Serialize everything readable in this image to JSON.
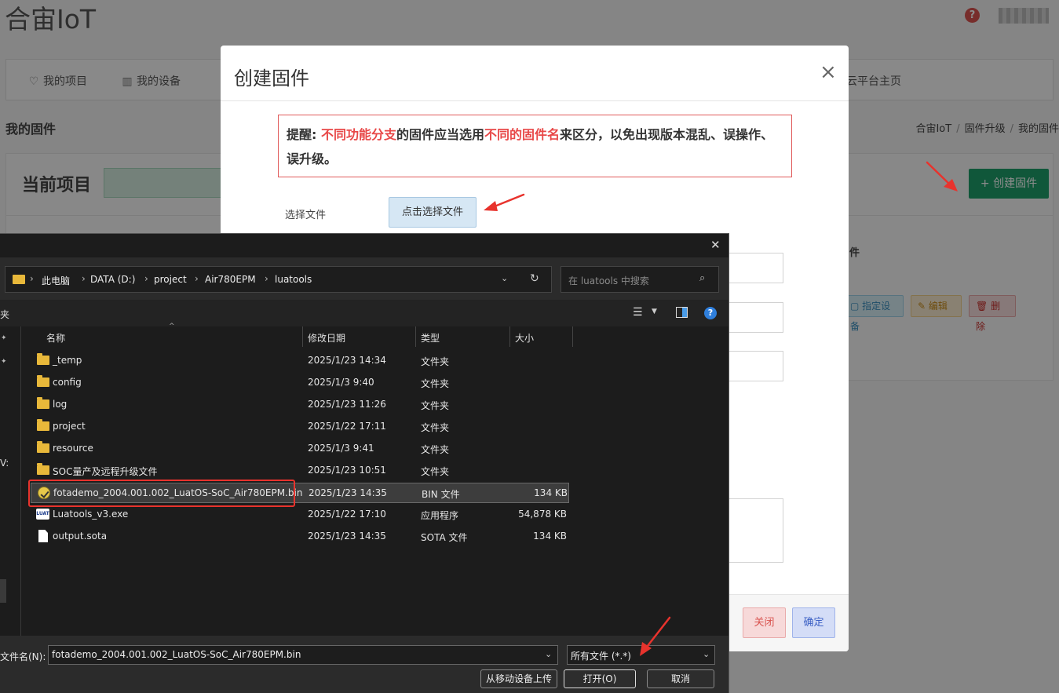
{
  "bg": {
    "brand": "合宙IoT",
    "help_icon": "?",
    "nav": [
      {
        "label": "我的项目",
        "icon": "lightbulb-icon",
        "glyph": "♡"
      },
      {
        "label": "我的设备",
        "icon": "chip-icon",
        "glyph": "▥"
      },
      {
        "label": "云平台主页",
        "icon": "",
        "glyph": ""
      }
    ],
    "page_title": "我的固件",
    "breadcrumb": [
      "合宙IoT",
      "固件升级",
      "我的固件"
    ],
    "current_project": "当前项目",
    "create_button": "+ 创建固件",
    "column_header": "件",
    "actions": {
      "assign": "指定设备",
      "edit": "编辑",
      "delete": "删除"
    }
  },
  "modal": {
    "title": "创建固件",
    "close_glyph": "×",
    "notice": {
      "prefix": "提醒: ",
      "hl1": "不同功能分支",
      "mid": "的固件应当选用",
      "hl2": "不同的固件名",
      "suffix": "来区分，以免出现版本混乱、误操作、误升级。"
    },
    "select_file_label": "选择文件",
    "select_file_button": "点击选择文件",
    "close_button": "关闭",
    "ok_button": "确定"
  },
  "file_dialog": {
    "close_glyph": "✕",
    "breadcrumb": [
      "此电脑",
      "DATA (D:)",
      "project",
      "Air780EPM",
      "luatools"
    ],
    "search_placeholder": "在 luatools 中搜索",
    "toolbar_left": "夹",
    "nav_fragment": "V:",
    "columns": {
      "name": "名称",
      "date": "修改日期",
      "type": "类型",
      "size": "大小"
    },
    "files": [
      {
        "name": "_temp",
        "date": "2025/1/23 14:34",
        "type": "文件夹",
        "size": "",
        "icon": "folder-icon"
      },
      {
        "name": "config",
        "date": "2025/1/3 9:40",
        "type": "文件夹",
        "size": "",
        "icon": "folder-icon"
      },
      {
        "name": "log",
        "date": "2025/1/23 11:26",
        "type": "文件夹",
        "size": "",
        "icon": "folder-icon"
      },
      {
        "name": "project",
        "date": "2025/1/22 17:11",
        "type": "文件夹",
        "size": "",
        "icon": "folder-icon"
      },
      {
        "name": "resource",
        "date": "2025/1/3 9:41",
        "type": "文件夹",
        "size": "",
        "icon": "folder-icon"
      },
      {
        "name": "SOC量产及远程升级文件",
        "date": "2025/1/23 10:51",
        "type": "文件夹",
        "size": "",
        "icon": "folder-icon"
      },
      {
        "name": "fotademo_2004.001.002_LuatOS-SoC_Air780EPM.bin",
        "date": "2025/1/23 14:35",
        "type": "BIN 文件",
        "size": "134 KB",
        "icon": "bin-file-icon",
        "selected": true
      },
      {
        "name": "Luatools_v3.exe",
        "date": "2025/1/22 17:10",
        "type": "应用程序",
        "size": "54,878 KB",
        "icon": "exe-icon"
      },
      {
        "name": "output.sota",
        "date": "2025/1/23 14:35",
        "type": "SOTA 文件",
        "size": "134 KB",
        "icon": "file-icon"
      }
    ],
    "filename_label": "文件名(N):",
    "filename_value": "fotademo_2004.001.002_LuatOS-SoC_Air780EPM.bin",
    "filetype_value": "所有文件 (*.*)",
    "upload_button": "从移动设备上传",
    "open_button": "打开(O)",
    "cancel_button": "取消"
  },
  "colors": {
    "annotation_red": "#e8332d",
    "accent_green": "#1e9e6b",
    "notice_red": "#e84848"
  }
}
